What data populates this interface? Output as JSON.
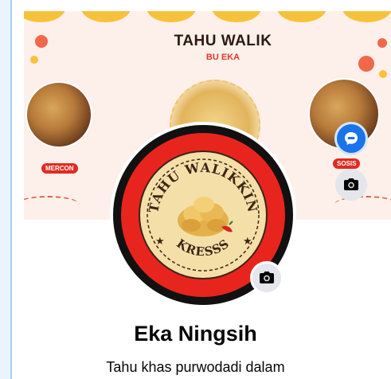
{
  "cover": {
    "title": "TAHU WALIK",
    "subtitle": "BU EKA",
    "left_label": "MERCON",
    "right_label": "SOSIS"
  },
  "logo": {
    "top_text": "TAHU WALIKKIN",
    "bottom_text": "KRESSS"
  },
  "profile": {
    "name": "Eka Ningsih",
    "bio": "Tahu khas purwodadi dalam"
  },
  "icons": {
    "messenger_button": "messenger-icon",
    "cover_camera": "camera-icon",
    "profile_camera": "camera-icon"
  },
  "colors": {
    "accent_blue": "#1a73e8",
    "cover_bg": "#fdf0ea",
    "logo_red": "#e8241e",
    "logo_cream": "#f4dfa8",
    "text_dark": "#050505"
  }
}
